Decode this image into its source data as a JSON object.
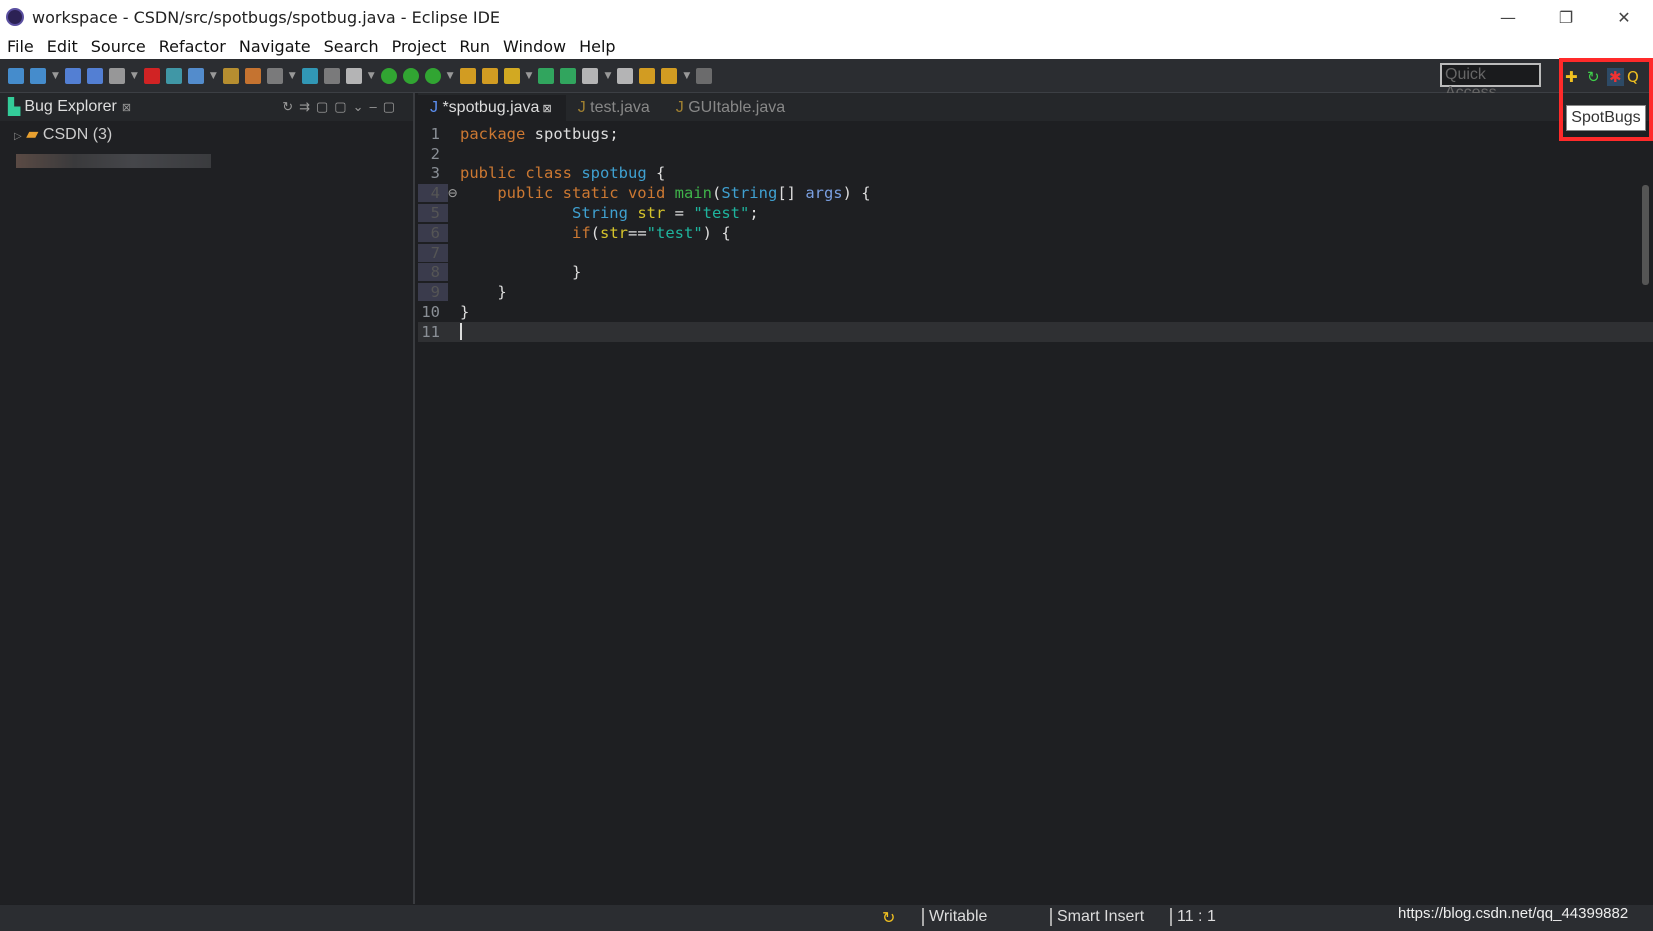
{
  "window": {
    "title": "workspace - CSDN/src/spotbugs/spotbug.java - Eclipse IDE",
    "minimize": "—",
    "restore": "❐",
    "close": "✕"
  },
  "menu": [
    "File",
    "Edit",
    "Source",
    "Refactor",
    "Navigate",
    "Search",
    "Project",
    "Run",
    "Window",
    "Help"
  ],
  "toolbar": {
    "quick_access_placeholder": "Quick Access",
    "tooltip": "SpotBugs"
  },
  "left_panel": {
    "title": "Bug Explorer",
    "close": "⊠",
    "tree": [
      {
        "label": "CSDN (3)"
      }
    ]
  },
  "editor": {
    "tabs": [
      {
        "label": "*spotbug.java",
        "active": true
      },
      {
        "label": "test.java"
      },
      {
        "label": "GUItable.java"
      }
    ],
    "lines": [
      [
        [
          "kw",
          "package"
        ],
        [
          "tx",
          " spotbugs;"
        ]
      ],
      [],
      [
        [
          "kw",
          "public class "
        ],
        [
          "cls",
          "spotbug"
        ],
        [
          "tx",
          " {"
        ]
      ],
      [
        [
          "tx",
          "    "
        ],
        [
          "kw",
          "public static void "
        ],
        [
          "fn",
          "main"
        ],
        [
          "tx",
          "("
        ],
        [
          "cls",
          "String"
        ],
        [
          "tx",
          "[] "
        ],
        [
          "arg",
          "args"
        ],
        [
          "tx",
          ") {"
        ]
      ],
      [
        [
          "tx",
          "            "
        ],
        [
          "cls",
          "String"
        ],
        [
          "tx",
          " "
        ],
        [
          "var",
          "str"
        ],
        [
          "tx",
          " = "
        ],
        [
          "str",
          "\"test\""
        ],
        [
          "tx",
          ";"
        ]
      ],
      [
        [
          "tx",
          "            "
        ],
        [
          "kw",
          "if"
        ],
        [
          "tx",
          "("
        ],
        [
          "var",
          "str"
        ],
        [
          "tx",
          "=="
        ],
        [
          "str",
          "\"test\""
        ],
        [
          "tx",
          ") {"
        ]
      ],
      [],
      [
        [
          "tx",
          "            }"
        ]
      ],
      [
        [
          "tx",
          "    }"
        ]
      ],
      [
        [
          "tx",
          "}"
        ]
      ],
      []
    ]
  },
  "status": {
    "mode": "Writable",
    "insert": "Smart Insert",
    "position": "11 : 1",
    "watermark": "https://blog.csdn.net/qq_44399882"
  }
}
